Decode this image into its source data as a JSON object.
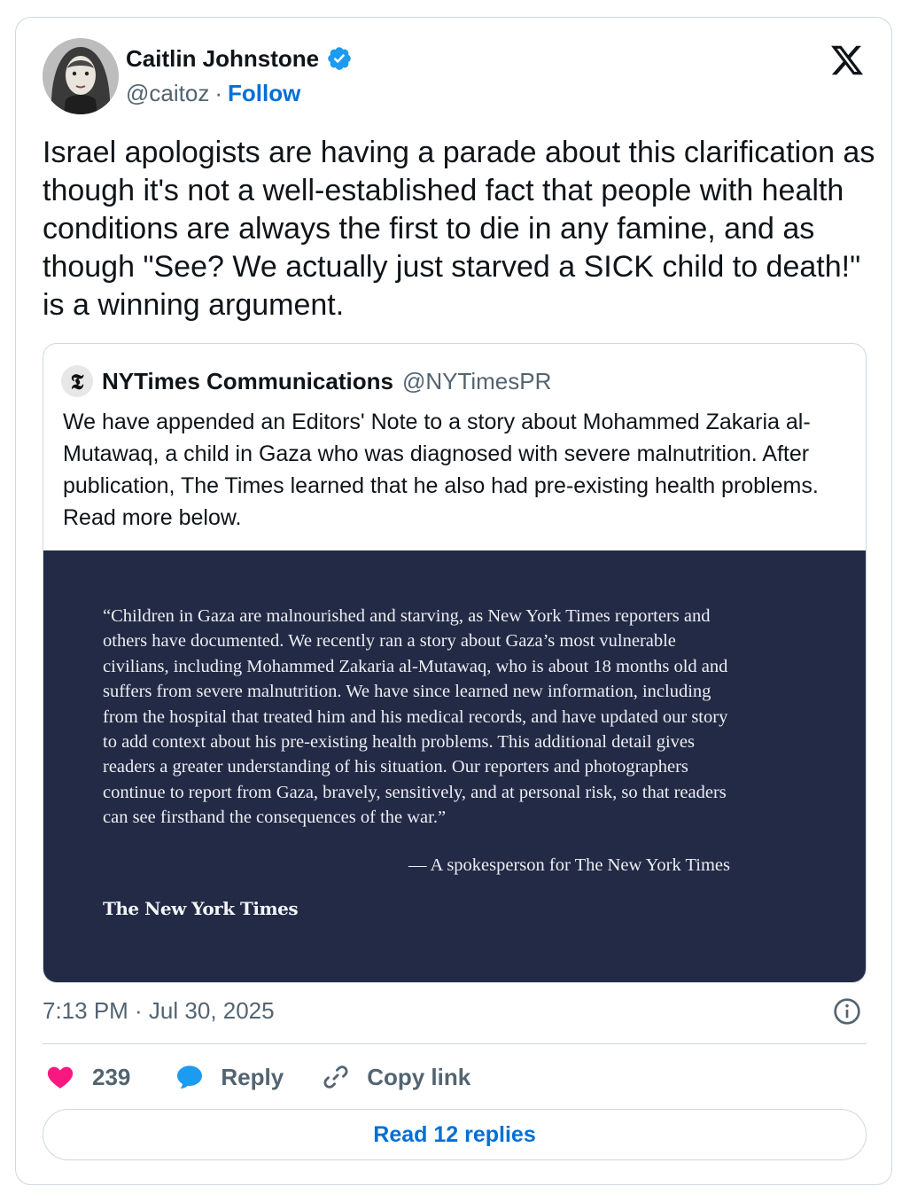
{
  "author": {
    "display_name": "Caitlin Johnstone",
    "handle": "@caitoz",
    "separator": "·",
    "follow_label": "Follow",
    "verified_color": "#1d9bf0"
  },
  "tweet": {
    "text": "Israel apologists are having a parade about this clarification as though it's not a well-established fact that people with health conditions are always the first to die in any famine, and as though \"See? We actually just starved a SICK child to death!\" is a winning argument.",
    "timestamp": "7:13 PM · Jul 30, 2025"
  },
  "quoted": {
    "avatar_glyph": "𝕿",
    "name": "NYTimes Communications",
    "handle": "@NYTimesPR",
    "text": "We have appended an Editors' Note to a story about Mohammed Zakaria al-Mutawaq, a child in Gaza who was diagnosed with severe malnutrition. After publication, The Times learned that he also had pre-existing health problems. Read more below.",
    "media": {
      "background": "#232a45",
      "statement": "“Children in Gaza are malnourished and starving, as New York Times reporters and others have documented. We recently ran a story about Gaza’s most vulnerable civilians, including Mohammed Zakaria al-Mutawaq, who is about 18 months old and suffers from severe malnutrition. We have since learned new information, including from the hospital that treated him and his medical records, and have updated our story to add context about his pre-existing health problems. This additional detail gives readers a greater understanding of his situation. Our reporters and photographers continue to report from Gaza, bravely, sensitively, and at personal risk, so that readers can see firsthand the consequences of the war.”",
      "attribution": "— A spokesperson for The New York Times",
      "logo_text": "The New York Times"
    }
  },
  "actions": {
    "like_count": "239",
    "reply_label": "Reply",
    "copy_label": "Copy link",
    "like_color": "#f91880",
    "reply_color": "#1d9bf0"
  },
  "read_replies_label": "Read 12 replies",
  "icons": {
    "x_logo": "x-logo-icon",
    "verified": "verified-badge-icon",
    "info": "info-icon",
    "heart": "heart-icon",
    "reply": "reply-bubble-icon",
    "link": "link-icon"
  }
}
